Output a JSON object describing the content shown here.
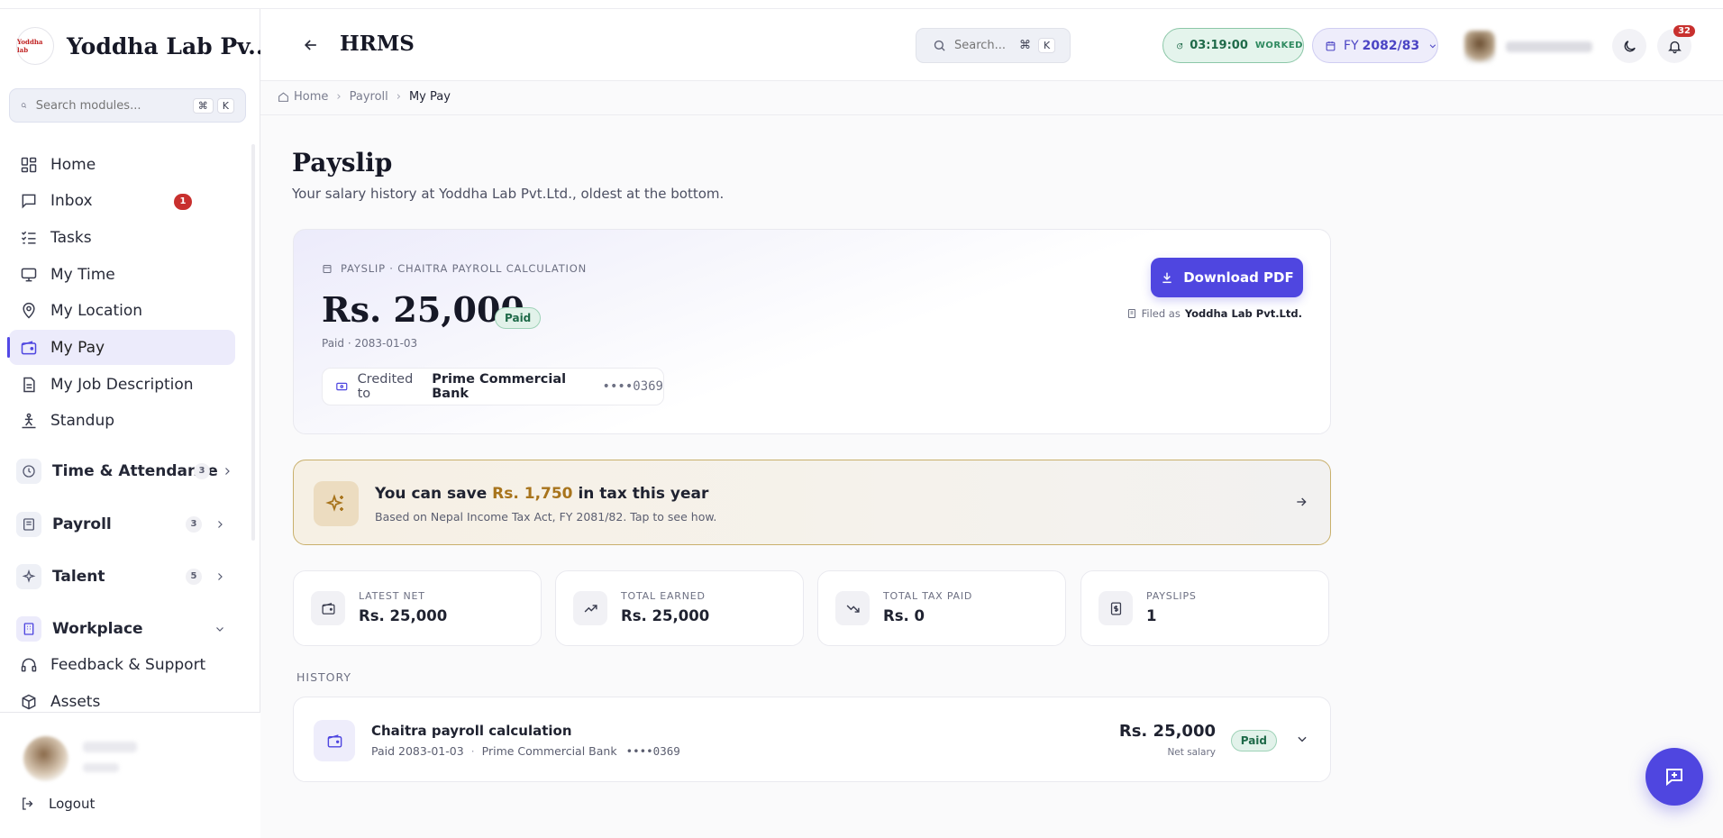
{
  "brand": {
    "name": "Yoddha Lab Pv...",
    "logo_text": "Yoddha lab"
  },
  "sidebar": {
    "search_placeholder": "Search modules...",
    "kbd_cmd": "⌘",
    "kbd_k": "K",
    "items": [
      {
        "label": "Home",
        "icon": "grid-icon"
      },
      {
        "label": "Inbox",
        "icon": "inbox-icon",
        "badge": "1"
      },
      {
        "label": "Tasks",
        "icon": "tasks-icon"
      },
      {
        "label": "My Time",
        "icon": "monitor-icon"
      },
      {
        "label": "My Location",
        "icon": "location-icon"
      },
      {
        "label": "My Pay",
        "icon": "wallet-icon",
        "active": true
      },
      {
        "label": "My Job Description",
        "icon": "document-icon"
      },
      {
        "label": "Standup",
        "icon": "standup-icon"
      }
    ],
    "groups": [
      {
        "label": "Time & Attendance",
        "count": "3"
      },
      {
        "label": "Payroll",
        "count": "3"
      },
      {
        "label": "Talent",
        "count": "5"
      },
      {
        "label": "Workplace",
        "count": ""
      }
    ],
    "extra_items": [
      {
        "label": "Feedback & Support"
      },
      {
        "label": "Assets"
      }
    ],
    "logout_label": "Logout"
  },
  "header": {
    "title": "HRMS",
    "search_placeholder": "Search...",
    "kbd_cmd": "⌘",
    "kbd_k": "K",
    "timer_value": "03:19:00",
    "timer_label": "WORKED",
    "fy_prefix": "FY",
    "fy_value": "2082/83",
    "notifications_count": "32"
  },
  "breadcrumb": {
    "home": "Home",
    "payroll": "Payroll",
    "current": "My Pay"
  },
  "page": {
    "title": "Payslip",
    "subtitle": "Your salary history at Yoddha Lab Pvt.Ltd., oldest at the bottom."
  },
  "hero": {
    "tag": "PAYSLIP · CHAITRA PAYROLL CALCULATION",
    "amount": "Rs. 25,000",
    "status": "Paid",
    "paid_date": "Paid · 2083-01-03",
    "credited_label": "Credited to",
    "bank": "Prime Commercial Bank",
    "account_mask": "••••0369",
    "download_label": "Download PDF",
    "filed_label": "Filed as",
    "filed_company": "Yoddha Lab Pvt.Ltd."
  },
  "tax": {
    "title_pre": "You can save",
    "amount": "Rs. 1,750",
    "title_post": "in tax this year",
    "subtitle": "Based on Nepal Income Tax Act, FY 2081/82. Tap to see how."
  },
  "stats": [
    {
      "label": "LATEST NET",
      "value": "Rs. 25,000",
      "icon": "wallet-icon"
    },
    {
      "label": "TOTAL EARNED",
      "value": "Rs. 25,000",
      "icon": "trending-up-icon"
    },
    {
      "label": "TOTAL TAX PAID",
      "value": "Rs. 0",
      "icon": "trending-down-icon"
    },
    {
      "label": "PAYSLIPS",
      "value": "1",
      "icon": "receipt-icon"
    }
  ],
  "history": {
    "label": "HISTORY",
    "rows": [
      {
        "title": "Chaitra payroll calculation",
        "paid": "Paid 2083-01-03",
        "bank": "Prime Commercial Bank",
        "account_mask": "••••0369",
        "amount": "Rs. 25,000",
        "amount_label": "Net salary",
        "status": "Paid"
      }
    ]
  },
  "colors": {
    "accent": "#4f46e0",
    "paid_green": "#1f6a49",
    "tax_gold": "#a8741c",
    "badge_red": "#c8302e"
  }
}
